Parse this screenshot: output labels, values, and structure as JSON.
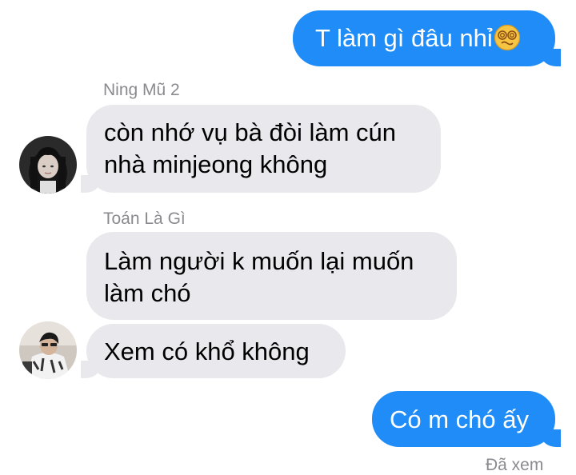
{
  "messages": [
    {
      "text": "T làm gì đâu nhỉ",
      "emoji": "dizzy-face-icon"
    },
    {
      "sender": "Ning Mũ 2",
      "lines": [
        "còn nhớ vụ bà đòi làm cún",
        "nhà minjeong không"
      ]
    },
    {
      "sender": "Toán Là Gì",
      "lines": [
        "Làm người k muốn lại muốn",
        "làm chó"
      ]
    },
    {
      "text": "Xem có khổ không"
    },
    {
      "text": "Có m chó ấy"
    }
  ],
  "read_receipt": "Đã xem",
  "colors": {
    "outgoing_bubble": "#1f8cf7",
    "incoming_bubble": "#e8e8ed",
    "meta_text": "#8a8a8f"
  }
}
